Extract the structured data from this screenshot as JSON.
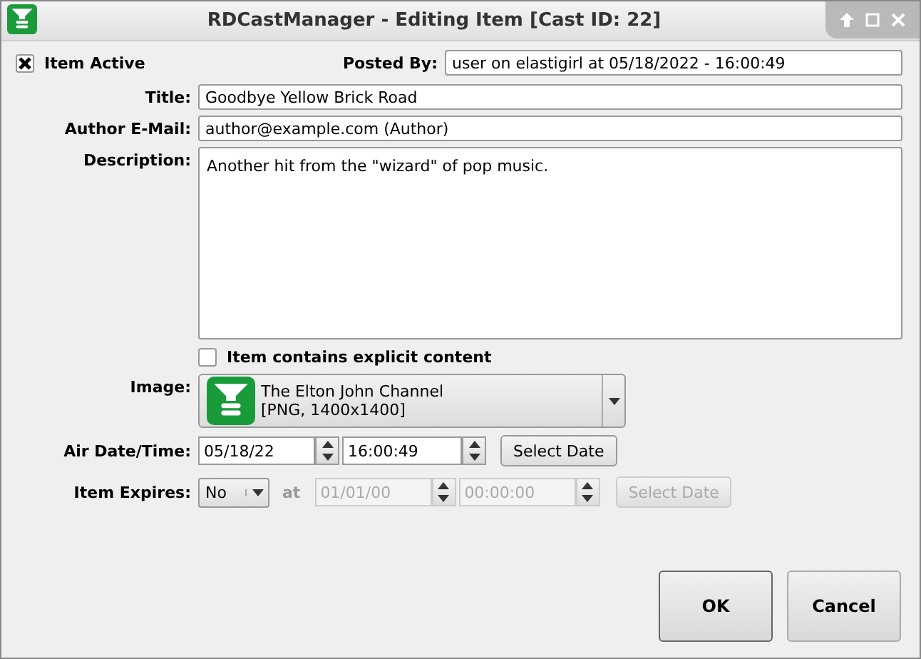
{
  "window": {
    "title": "RDCastManager - Editing Item  [Cast ID: 22]"
  },
  "item_active": {
    "label": "Item Active",
    "checked": true
  },
  "posted_by": {
    "label": "Posted By:",
    "value": "user on elastigirl at 05/18/2022 - 16:00:49"
  },
  "fields": [
    {
      "label": "Title:",
      "value": "Goodbye Yellow Brick Road"
    },
    {
      "label": "Author E-Mail:",
      "value": "author@example.com (Author)"
    }
  ],
  "description": {
    "label": "Description:",
    "value": "Another hit from the \"wizard\" of pop music."
  },
  "explicit": {
    "label": "Item contains explicit content",
    "checked": false
  },
  "image": {
    "label": "Image:",
    "name": "The Elton John Channel",
    "info": "[PNG, 1400x1400]"
  },
  "air": {
    "label": "Air Date/Time:",
    "date": "05/18/22",
    "time": "16:00:49",
    "button": "Select Date",
    "disabled": false
  },
  "expires": {
    "label": "Item Expires:",
    "value": "No",
    "at": "at",
    "date": "01/01/00",
    "time": "00:00:00",
    "button": "Select Date",
    "disabled": true
  },
  "buttons": [
    "OK",
    "Cancel"
  ]
}
